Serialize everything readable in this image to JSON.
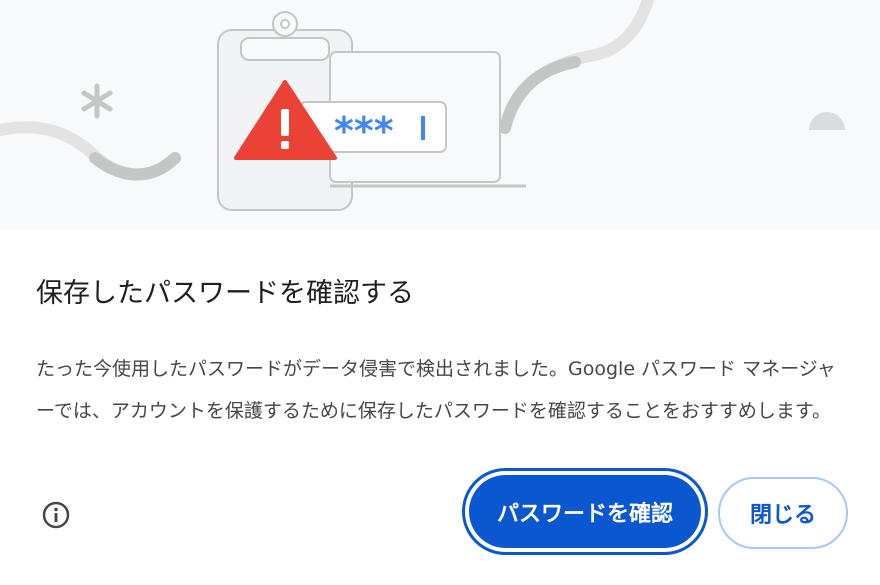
{
  "dialog": {
    "title": "保存したパスワードを確認する",
    "body": "たった今使用したパスワードがデータ侵害で検出されました。Google パスワード マネージャーでは、アカウントを保護するために保存したパスワードを確認することをおすすめします。",
    "illustration": {
      "password_mask": "***",
      "warning_icon": "warning-triangle-icon"
    },
    "buttons": {
      "check_passwords": "パスワードを確認",
      "close": "閉じる"
    },
    "info_icon": "info-icon"
  },
  "colors": {
    "accent": "#0b57d0",
    "accent_light": "#a8c7fa",
    "warning": "#ea4335",
    "password_blue": "#4285f4",
    "illustration_bg": "#f8f9fa"
  }
}
